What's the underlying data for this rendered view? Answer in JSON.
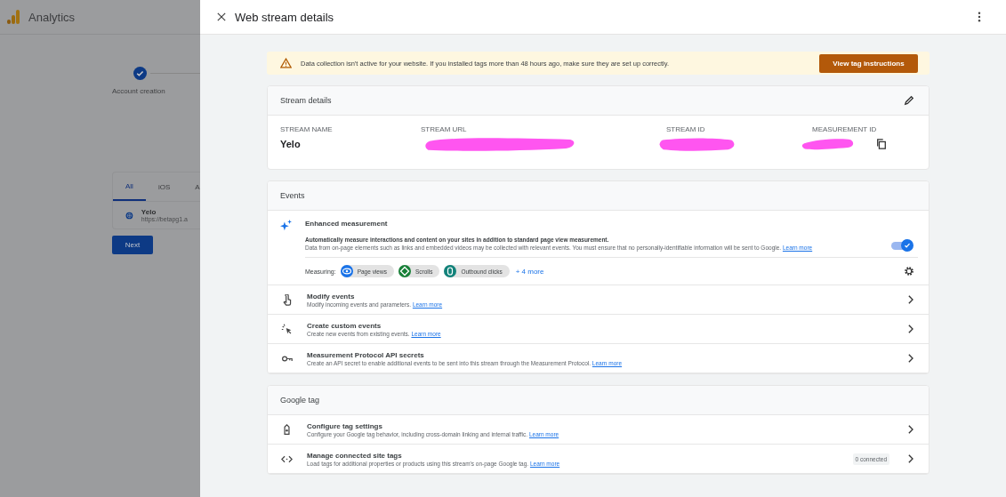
{
  "background_page": {
    "app_name": "Analytics",
    "stepper": [
      {
        "label": "Account creation",
        "done": true
      }
    ],
    "platform_tabs": [
      {
        "label": "All",
        "selected": true
      },
      {
        "label": "iOS",
        "selected": false
      },
      {
        "label": "A",
        "selected": false
      }
    ],
    "streams": [
      {
        "name": "Yelo",
        "url": "https://betapg1.a"
      }
    ],
    "next_button": "Next"
  },
  "panel": {
    "title": "Web stream details",
    "alert": {
      "message": "Data collection isn't active for your website. If you installed tags more than 48 hours ago, make sure they are set up correctly.",
      "button": "View tag instructions"
    },
    "stream_details": {
      "title": "Stream details",
      "fields": [
        {
          "label": "STREAM NAME",
          "value": "Yelo"
        },
        {
          "label": "STREAM URL"
        },
        {
          "label": "STREAM ID"
        },
        {
          "label": "MEASUREMENT ID",
          "copyable": true
        }
      ]
    },
    "events": {
      "title": "Events",
      "enhanced": {
        "title": "Enhanced measurement",
        "description": "Automatically measure interactions and content on your sites in addition to standard page view measurement.",
        "note": "Data from on-page elements such as links and embedded videos may be collected with relevant events. You must ensure that no personally-identifiable information will be sent to Google.",
        "link": "Learn more",
        "on": true,
        "measuring_label": "Measuring:",
        "chips": [
          {
            "label": "Page views",
            "kind": "eye",
            "color": "#1a73e8"
          },
          {
            "label": "Scrolls",
            "kind": "scroll",
            "color": "#188038"
          },
          {
            "label": "Outbound clicks",
            "kind": "mouse",
            "color": "#12827a"
          }
        ],
        "more": "+ 4 more"
      },
      "rows": [
        {
          "kind": "hand",
          "title": "Modify events",
          "description": "Modify incoming events and parameters.",
          "link": "Learn more"
        },
        {
          "kind": "sparkle",
          "title": "Create custom events",
          "description": "Create new events from existing events.",
          "link": "Learn more"
        },
        {
          "kind": "key",
          "title": "Measurement Protocol API secrets",
          "description": "Create an API secret to enable additional events to be sent into this stream through the Measurement Protocol.",
          "link": "Learn more"
        }
      ]
    },
    "google_tag": {
      "title": "Google tag",
      "rows": [
        {
          "kind": "tag",
          "title": "Configure tag settings",
          "description": "Configure your Google tag behavior, including cross-domain linking and internal traffic.",
          "link": "Learn more"
        },
        {
          "kind": "code",
          "title": "Manage connected site tags",
          "description": "Load tags for additional properties or products using this stream's on-page Google tag.",
          "link": "Learn more",
          "badge": "0 connected"
        }
      ]
    }
  }
}
